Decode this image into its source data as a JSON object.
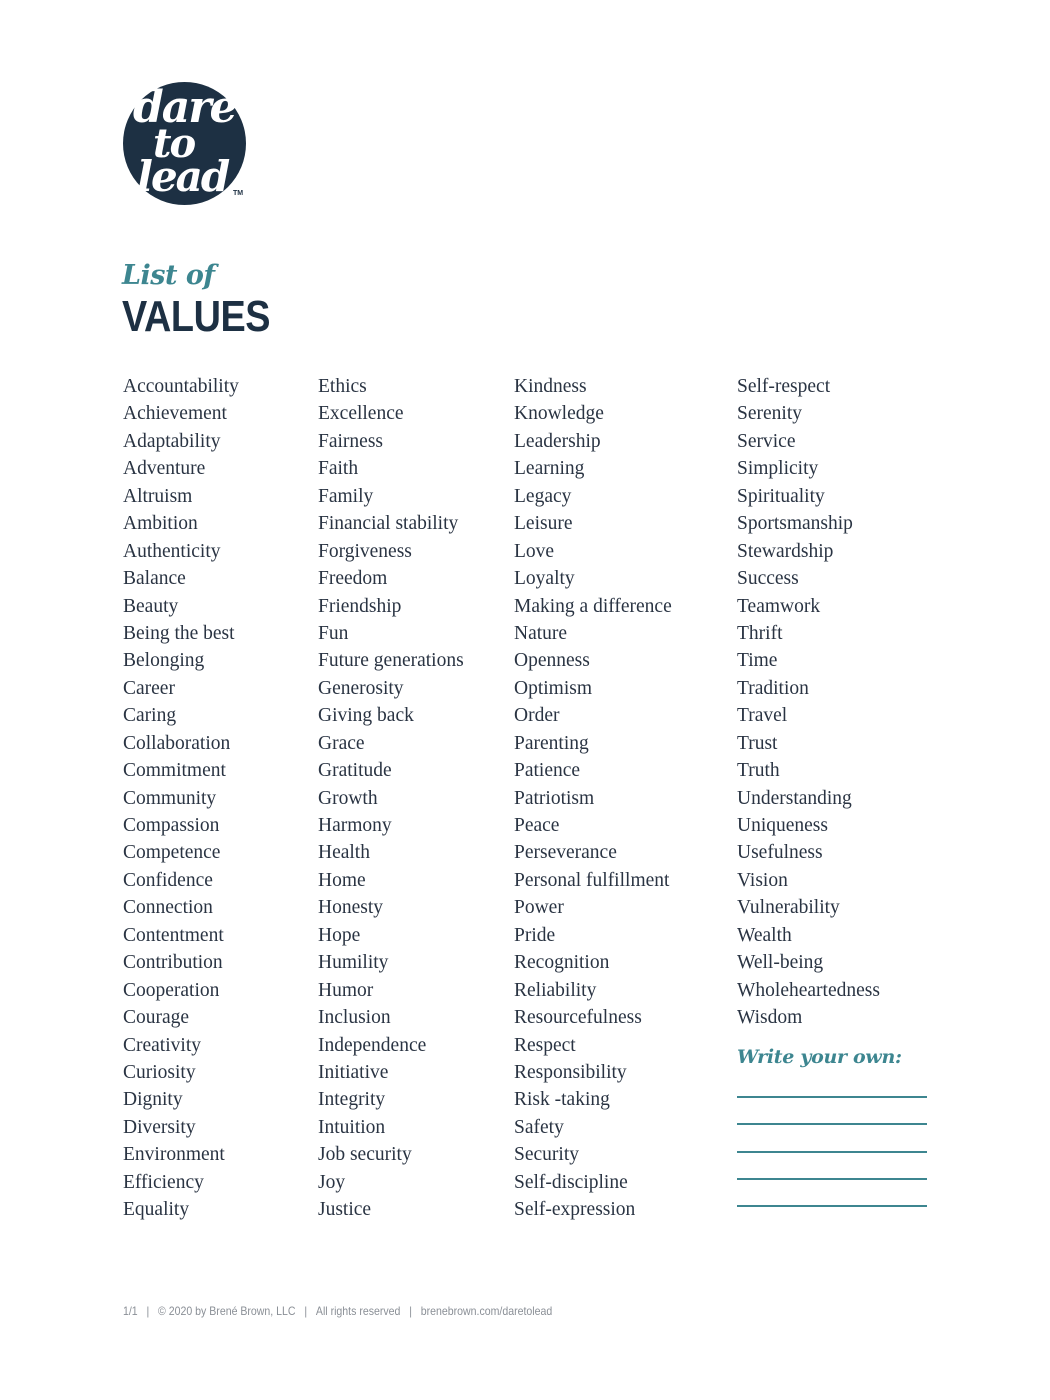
{
  "logo": {
    "line1": "dare",
    "line2": "to",
    "line3": "lead",
    "trademark": "TM"
  },
  "title": {
    "subtitle": "List of",
    "main": "VALUES"
  },
  "columns": [
    [
      "Accountability",
      "Achievement",
      "Adaptability",
      "Adventure",
      "Altruism",
      "Ambition",
      "Authenticity",
      "Balance",
      "Beauty",
      "Being the best",
      "Belonging",
      "Career",
      "Caring",
      "Collaboration",
      "Commitment",
      "Community",
      "Compassion",
      "Competence",
      "Confidence",
      "Connection",
      "Contentment",
      "Contribution",
      "Cooperation",
      "Courage",
      "Creativity",
      "Curiosity",
      "Dignity",
      "Diversity",
      "Environment",
      "Efficiency",
      "Equality"
    ],
    [
      "Ethics",
      "Excellence",
      "Fairness",
      "Faith",
      "Family",
      "Financial stability",
      "Forgiveness",
      "Freedom",
      "Friendship",
      "Fun",
      "Future generations",
      "Generosity",
      "Giving back",
      "Grace",
      "Gratitude",
      "Growth",
      "Harmony",
      "Health",
      "Home",
      "Honesty",
      "Hope",
      "Humility",
      "Humor",
      "Inclusion",
      "Independence",
      "Initiative",
      "Integrity",
      "Intuition",
      "Job security",
      "Joy",
      "Justice"
    ],
    [
      "Kindness",
      "Knowledge",
      "Leadership",
      "Learning",
      "Legacy",
      "Leisure",
      "Love",
      "Loyalty",
      "Making a difference",
      "Nature",
      "Openness",
      "Optimism",
      "Order",
      "Parenting",
      "Patience",
      "Patriotism",
      "Peace",
      "Perseverance",
      "Personal fulfillment",
      "Power",
      "Pride",
      "Recognition",
      "Reliability",
      "Resourcefulness",
      "Respect",
      "Responsibility",
      "Risk -taking",
      "Safety",
      "Security",
      "Self-discipline",
      "Self-expression"
    ],
    [
      "Self-respect",
      "Serenity",
      "Service",
      "Simplicity",
      "Spirituality",
      "Sportsmanship",
      "Stewardship",
      "Success",
      "Teamwork",
      "Thrift",
      "Time",
      "Tradition",
      "Travel",
      "Trust",
      "Truth",
      "Understanding",
      "Uniqueness",
      "Usefulness",
      "Vision",
      "Vulnerability",
      "Wealth",
      "Well-being",
      "Wholeheartedness",
      "Wisdom"
    ]
  ],
  "write_your_own": {
    "label": "Write your own:",
    "blank_lines": 5
  },
  "footer": {
    "page": "1/1",
    "copyright": "© 2020 by Brené Brown, LLC",
    "rights": "All rights reserved",
    "url": "brenebrown.com/daretolead",
    "separator": "|"
  },
  "colors": {
    "navy": "#1d3043",
    "teal": "#3d8690",
    "text": "#2a3443",
    "footer": "#8a8f96"
  }
}
